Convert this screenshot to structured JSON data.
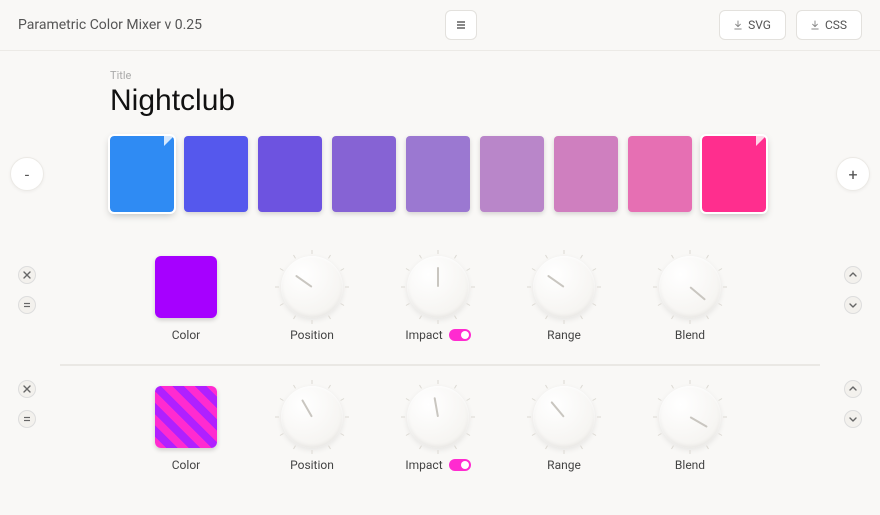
{
  "header": {
    "app_title": "Parametric Color Mixer v 0.25",
    "export_svg": "SVG",
    "export_css": "CSS"
  },
  "title": {
    "hint": "Title",
    "value": "Nightclub"
  },
  "swatch_buttons": {
    "remove": "-",
    "add": "+"
  },
  "swatches": [
    {
      "color": "#2f8bf3",
      "selected": true,
      "dog_ear": true
    },
    {
      "color": "#5558ed",
      "selected": false,
      "dog_ear": false
    },
    {
      "color": "#6d53e0",
      "selected": false,
      "dog_ear": false
    },
    {
      "color": "#8663d4",
      "selected": false,
      "dog_ear": false
    },
    {
      "color": "#9b78d1",
      "selected": false,
      "dog_ear": false
    },
    {
      "color": "#b986c9",
      "selected": false,
      "dog_ear": false
    },
    {
      "color": "#cf7fbf",
      "selected": false,
      "dog_ear": false
    },
    {
      "color": "#e66fb3",
      "selected": false,
      "dog_ear": false
    },
    {
      "color": "#ff2e8e",
      "selected": true,
      "dog_ear": true
    }
  ],
  "layers": [
    {
      "color_label": "Color",
      "color": "#a600ff",
      "striped": false,
      "knobs": [
        {
          "label": "Position",
          "angle": -55,
          "toggle": null
        },
        {
          "label": "Impact",
          "angle": 0,
          "toggle": true
        },
        {
          "label": "Range",
          "angle": -55,
          "toggle": null
        },
        {
          "label": "Blend",
          "angle": 130,
          "toggle": null
        }
      ]
    },
    {
      "color_label": "Color",
      "color": "#ff2bd0",
      "striped": true,
      "knobs": [
        {
          "label": "Position",
          "angle": -30,
          "toggle": null
        },
        {
          "label": "Impact",
          "angle": -10,
          "toggle": true
        },
        {
          "label": "Range",
          "angle": -40,
          "toggle": null
        },
        {
          "label": "Blend",
          "angle": 120,
          "toggle": null
        }
      ]
    }
  ]
}
